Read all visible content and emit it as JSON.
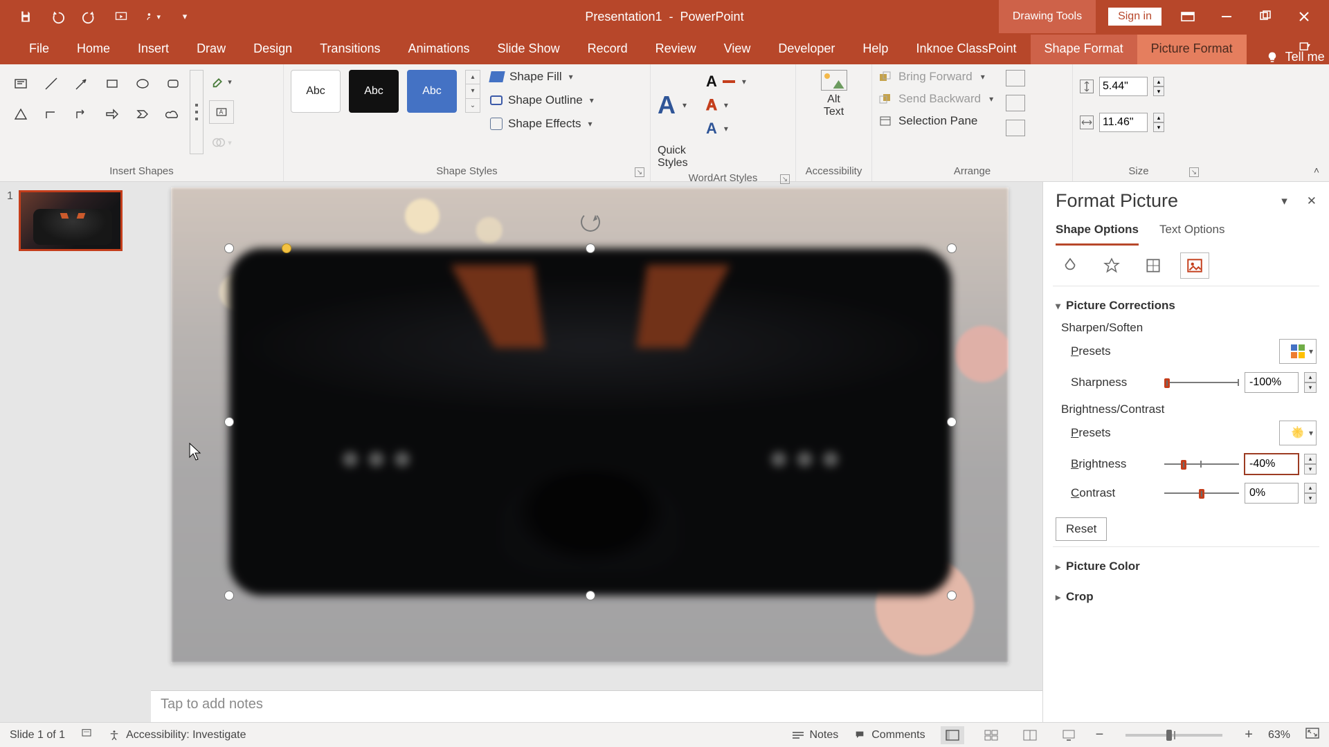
{
  "title": {
    "doc": "Presentation1",
    "app": "PowerPoint",
    "context_tool": "Drawing Tools",
    "signin": "Sign in"
  },
  "tabs": [
    "File",
    "Home",
    "Insert",
    "Draw",
    "Design",
    "Transitions",
    "Animations",
    "Slide Show",
    "Record",
    "Review",
    "View",
    "Developer",
    "Help",
    "Inknoe ClassPoint"
  ],
  "context_tabs": {
    "shape": "Shape Format",
    "picture": "Picture Format"
  },
  "tell_me": "Tell me",
  "ribbon": {
    "insert_shapes_label": "Insert Shapes",
    "shape_styles_label": "Shape Styles",
    "swatch_text": "Abc",
    "shape_fill": "Shape Fill",
    "shape_outline": "Shape Outline",
    "shape_effects": "Shape Effects",
    "wordart_label": "WordArt Styles",
    "quick_styles": "Quick\nStyles",
    "accessibility_label": "Accessibility",
    "alt_text": "Alt\nText",
    "arrange_label": "Arrange",
    "bring_forward": "Bring Forward",
    "send_backward": "Send Backward",
    "selection_pane": "Selection Pane",
    "size_label": "Size",
    "height": "5.44\"",
    "width": "11.46\""
  },
  "slide": {
    "thumb_index": "1",
    "notes_placeholder": "Tap to add notes"
  },
  "pane": {
    "title": "Format Picture",
    "tab_shape": "Shape Options",
    "tab_text": "Text Options",
    "section_corrections": "Picture Corrections",
    "sharpen_soften": "Sharpen/Soften",
    "presets": "Presets",
    "sharpness": "Sharpness",
    "sharpness_val": "-100%",
    "bc": "Brightness/Contrast",
    "brightness": "Brightness",
    "brightness_val": "-40%",
    "contrast": "Contrast",
    "contrast_val": "0%",
    "reset": "Reset",
    "picture_color": "Picture Color",
    "crop": "Crop"
  },
  "status": {
    "slide_of": "Slide 1 of 1",
    "accessibility": "Accessibility: Investigate",
    "notes": "Notes",
    "comments": "Comments",
    "zoom": "63%"
  }
}
